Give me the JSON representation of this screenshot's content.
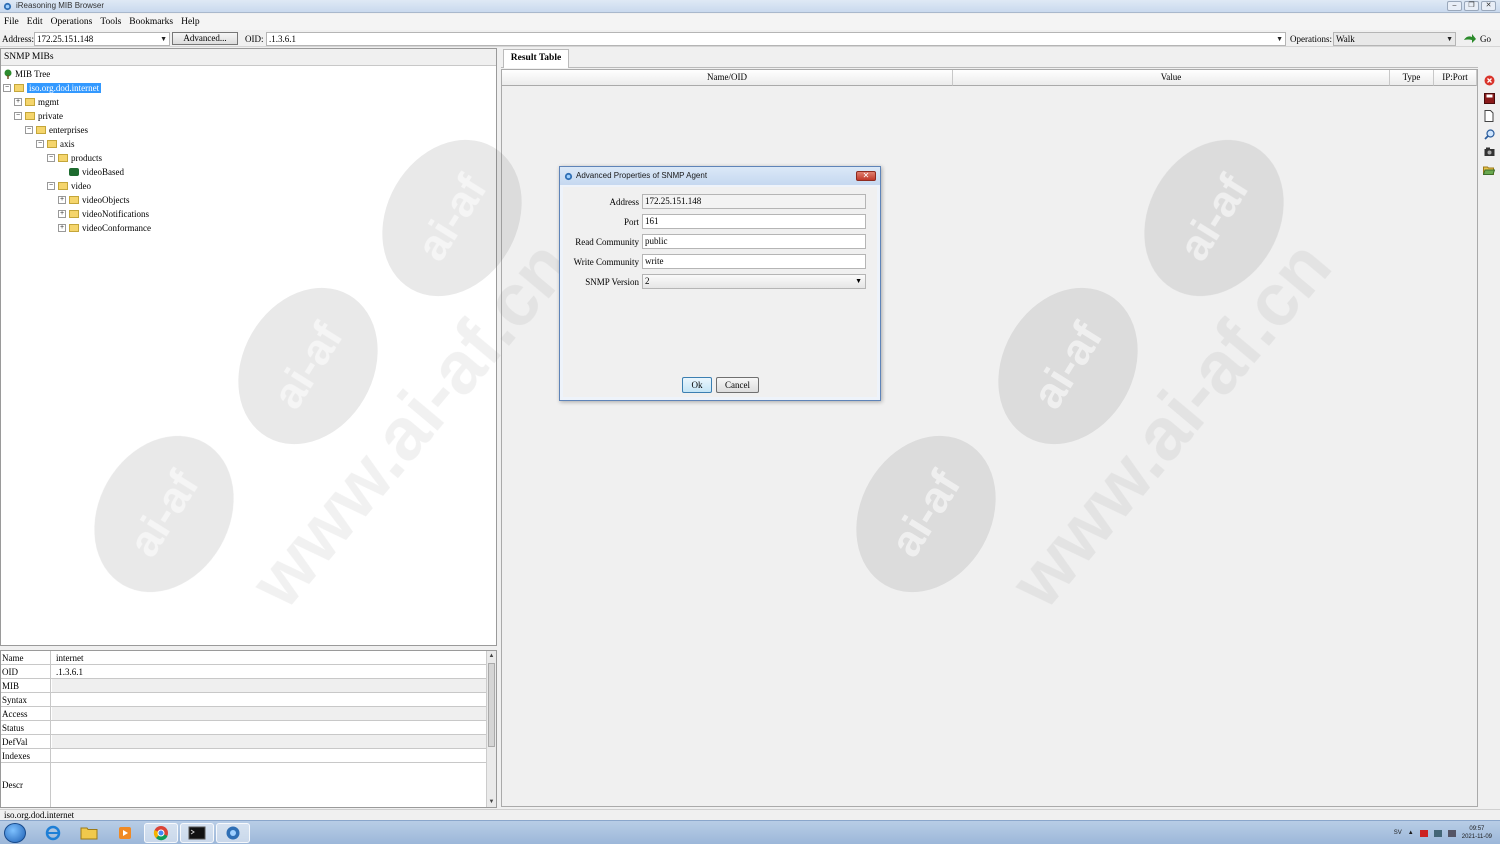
{
  "window": {
    "title": "iReasoning MIB Browser",
    "controls": [
      "‒",
      "❐",
      "✕"
    ]
  },
  "menu": [
    "File",
    "Edit",
    "Operations",
    "Tools",
    "Bookmarks",
    "Help"
  ],
  "toolbar": {
    "address_label": "Address:",
    "address_value": "172.25.151.148",
    "advanced_label": "Advanced...",
    "oid_label": "OID:",
    "oid_value": ".1.3.6.1",
    "operations_label": "Operations:",
    "operations_value": "Walk",
    "go_label": "Go"
  },
  "left_panel": {
    "header": "SNMP MIBs",
    "tree": [
      {
        "label": "MIB Tree",
        "level": 0,
        "icon": "tree-icon"
      },
      {
        "label": "iso.org.dod.internet",
        "level": 0,
        "expander": "−",
        "icon": "folder-icon",
        "selected": true
      },
      {
        "label": "mgmt",
        "level": 1,
        "expander": "+",
        "icon": "folder-icon"
      },
      {
        "label": "private",
        "level": 1,
        "expander": "−",
        "icon": "folder-icon"
      },
      {
        "label": "enterprises",
        "level": 2,
        "expander": "−",
        "icon": "folder-icon"
      },
      {
        "label": "axis",
        "level": 3,
        "expander": "−",
        "icon": "folder-icon"
      },
      {
        "label": "products",
        "level": 4,
        "expander": "−",
        "icon": "folder-icon"
      },
      {
        "label": "videoBased",
        "level": 5,
        "icon": "leaf-icon"
      },
      {
        "label": "video",
        "level": 4,
        "expander": "−",
        "icon": "folder-icon"
      },
      {
        "label": "videoObjects",
        "level": 5,
        "expander": "+",
        "icon": "folder-icon"
      },
      {
        "label": "videoNotifications",
        "level": 5,
        "expander": "+",
        "icon": "folder-icon"
      },
      {
        "label": "videoConformance",
        "level": 5,
        "expander": "+",
        "icon": "folder-icon"
      }
    ]
  },
  "properties": [
    {
      "key": "Name",
      "value": "internet"
    },
    {
      "key": "OID",
      "value": ".1.3.6.1"
    },
    {
      "key": "MIB",
      "value": ""
    },
    {
      "key": "Syntax",
      "value": ""
    },
    {
      "key": "Access",
      "value": ""
    },
    {
      "key": "Status",
      "value": ""
    },
    {
      "key": "DefVal",
      "value": ""
    },
    {
      "key": "Indexes",
      "value": ""
    },
    {
      "key": "Descr",
      "value": ""
    }
  ],
  "status_bar": "iso.org.dod.internet",
  "result": {
    "tab": "Result Table",
    "columns": [
      "Name/OID",
      "Value",
      "Type",
      "IP:Port"
    ]
  },
  "side_tools": [
    "stop-icon",
    "save-icon",
    "document-icon",
    "find-icon",
    "graph-icon",
    "open-folder-icon"
  ],
  "watermark_texts": [
    "ai-af",
    "www.ai-af.cn"
  ],
  "dialog": {
    "title": "Advanced Properties of SNMP Agent",
    "close": "✕",
    "fields": [
      {
        "label": "Address",
        "value": "172.25.151.148",
        "readonly": true
      },
      {
        "label": "Port",
        "value": "161"
      },
      {
        "label": "Read Community",
        "value": "public"
      },
      {
        "label": "Write Community",
        "value": "write"
      },
      {
        "label": "SNMP Version",
        "value": "2",
        "dropdown": true
      }
    ],
    "ok_label": "Ok",
    "cancel_label": "Cancel"
  },
  "taskbar": {
    "apps": [
      "ie-icon",
      "explorer-icon",
      "media-player-icon",
      "chrome-icon",
      "terminal-icon",
      "mib-browser-icon"
    ],
    "tray_lang": "SV",
    "time": "09:57",
    "date": "2021-11-09"
  },
  "colors": {
    "selection": "#3399ff",
    "dialog_border": "#5f84b8",
    "taskbar": "#9cb7d9"
  }
}
